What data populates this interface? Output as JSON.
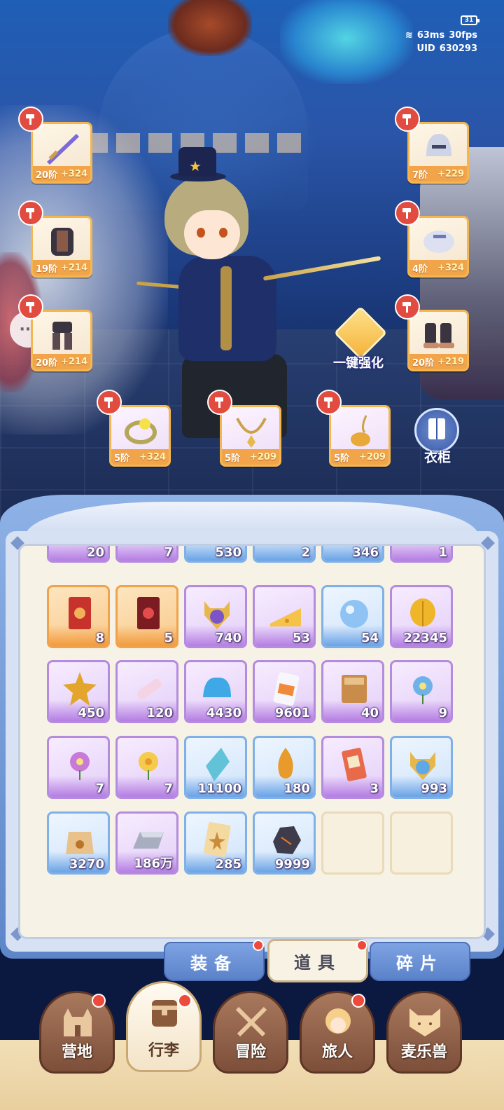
{
  "hud": {
    "battery": "31",
    "ping": "63ms",
    "fps": "30fps",
    "uid_label": "UID",
    "uid_value": "630293"
  },
  "equipment": {
    "left": [
      {
        "tier": "20阶",
        "bonus": "+324",
        "icon": "sword-icon"
      },
      {
        "tier": "19阶",
        "bonus": "+214",
        "icon": "chest-armor-icon"
      },
      {
        "tier": "20阶",
        "bonus": "+214",
        "icon": "leg-armor-icon"
      }
    ],
    "right": [
      {
        "tier": "7阶",
        "bonus": "+229",
        "icon": "helmet-icon"
      },
      {
        "tier": "4阶",
        "bonus": "+324",
        "icon": "gauntlet-icon"
      },
      {
        "tier": "20阶",
        "bonus": "+219",
        "icon": "boots-icon"
      }
    ],
    "bottom": [
      {
        "tier": "5阶",
        "bonus": "+324",
        "icon": "ring-icon"
      },
      {
        "tier": "5阶",
        "bonus": "+209",
        "icon": "necklace-icon"
      },
      {
        "tier": "5阶",
        "bonus": "+209",
        "icon": "amulet-icon"
      }
    ],
    "one_click_label": "一键强化",
    "wardrobe_label": "衣柜"
  },
  "inventory": {
    "partial_row": [
      "20",
      "7",
      "530",
      "2",
      "346",
      "1"
    ],
    "rows": [
      [
        {
          "qty": "8",
          "rarity": "orange",
          "icon": "red-card-icon"
        },
        {
          "qty": "5",
          "rarity": "orange",
          "icon": "dark-red-card-icon"
        },
        {
          "qty": "740",
          "rarity": "purple",
          "icon": "cat-medal-icon"
        },
        {
          "qty": "53",
          "rarity": "purple",
          "icon": "cheese-icon"
        },
        {
          "qty": "54",
          "rarity": "blue",
          "icon": "bubble-orb-icon"
        },
        {
          "qty": "22345",
          "rarity": "purple",
          "icon": "golden-leaf-icon"
        }
      ],
      [
        {
          "qty": "450",
          "rarity": "purple",
          "icon": "star-gem-icon"
        },
        {
          "qty": "120",
          "rarity": "purple",
          "icon": "paint-tube-icon"
        },
        {
          "qty": "4430",
          "rarity": "purple",
          "icon": "blue-slime-icon"
        },
        {
          "qty": "9601",
          "rarity": "purple",
          "icon": "snack-bag-icon"
        },
        {
          "qty": "40",
          "rarity": "purple",
          "icon": "book-icon"
        },
        {
          "qty": "9",
          "rarity": "purple",
          "icon": "blue-flower-icon"
        }
      ],
      [
        {
          "qty": "7",
          "rarity": "purple",
          "icon": "pink-flower-icon"
        },
        {
          "qty": "7",
          "rarity": "purple",
          "icon": "yellow-flower-icon"
        },
        {
          "qty": "11100",
          "rarity": "blue",
          "icon": "crystal-shard-icon"
        },
        {
          "qty": "180",
          "rarity": "blue",
          "icon": "amber-icon"
        },
        {
          "qty": "3",
          "rarity": "purple",
          "icon": "ticket-icon"
        },
        {
          "qty": "993",
          "rarity": "blue",
          "icon": "cat-medal-blue-icon"
        }
      ],
      [
        {
          "qty": "3270",
          "rarity": "blue",
          "icon": "pet-food-bag-icon"
        },
        {
          "qty": "186万",
          "rarity": "purple",
          "icon": "silver-ingot-icon"
        },
        {
          "qty": "285",
          "rarity": "blue",
          "icon": "star-card-icon"
        },
        {
          "qty": "9999",
          "rarity": "blue",
          "icon": "ore-icon"
        },
        {
          "qty": "",
          "rarity": "empty",
          "icon": ""
        },
        {
          "qty": "",
          "rarity": "empty",
          "icon": ""
        }
      ]
    ]
  },
  "tabs": [
    {
      "label": "装备",
      "active": false,
      "badge": true
    },
    {
      "label": "道具",
      "active": true,
      "badge": true
    },
    {
      "label": "碎片",
      "active": false,
      "badge": false
    }
  ],
  "nav": [
    {
      "label": "营地",
      "icon": "castle-icon",
      "active": false,
      "badge": true
    },
    {
      "label": "行李",
      "icon": "backpack-icon",
      "active": true,
      "badge": true
    },
    {
      "label": "冒险",
      "icon": "crossed-swords-icon",
      "active": false,
      "badge": false
    },
    {
      "label": "旅人",
      "icon": "traveler-icon",
      "active": false,
      "badge": true
    },
    {
      "label": "麦乐兽",
      "icon": "cat-face-icon",
      "active": false,
      "badge": false
    }
  ]
}
